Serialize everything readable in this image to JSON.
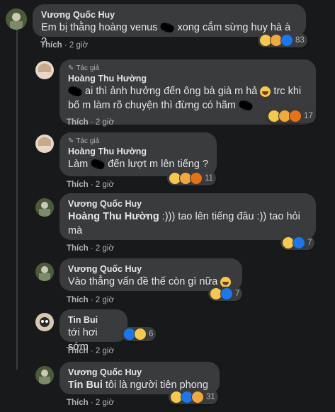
{
  "common": {
    "like_label": "Thích",
    "time_label": "2 giờ",
    "sep": " · "
  },
  "badge_label": "Tác giả",
  "c1": {
    "author": "Vương Quốc Huy",
    "text_a": "Em bị thằng hoàng venus ",
    "text_b": " xong cắm sừng huy hà à ?",
    "reactions": "83"
  },
  "c2": {
    "author": "Hoàng Thu Hường",
    "text_a": " ai thì ảnh hưởng đến ông bà già m hả ",
    "text_b": " trc khi bố m làm rõ chuyện thì đừng có hãm ",
    "reactions": "17"
  },
  "c3": {
    "author": "Hoàng Thu Hường",
    "text_a": "Làm ",
    "text_b": " đến lượt m lên tiếng ?",
    "reactions": "11"
  },
  "c4": {
    "author": "Vương Quốc Huy",
    "mention": "Hoàng Thu Hường",
    "text": " :))) tao lên tiếng đâu :)) tao hỏi mà",
    "reactions": "7"
  },
  "c5": {
    "author": "Vương Quốc Huy",
    "text": "Vào thẳng vấn đề thế còn gì nữa ",
    "reactions": "7"
  },
  "c6": {
    "author": "Tin Bui",
    "text": "tới hơi sớm",
    "reactions": "6"
  },
  "c7": {
    "author": "Vương Quốc Huy",
    "mention": "Tin Bui",
    "text": " tôi là người tiên phong",
    "reactions": "31"
  },
  "colors": {
    "bg": "#18191a",
    "bubble": "#3a3b3c",
    "haha": "#f7c94b",
    "like": "#1877f2",
    "sad": "#f7c94b"
  }
}
